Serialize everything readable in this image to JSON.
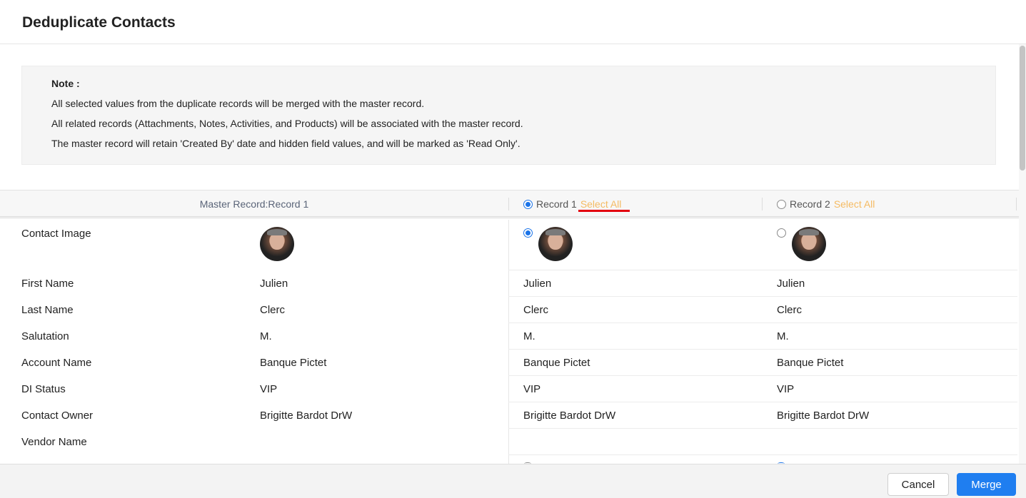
{
  "title": "Deduplicate Contacts",
  "note": {
    "title": "Note :",
    "lines": [
      "All selected values from the duplicate records will be merged with the master record.",
      "All related records (Attachments, Notes, Activities, and Products) will be associated with the master record.",
      "The master record will retain 'Created By' date and hidden field values, and will be marked as 'Read Only'."
    ]
  },
  "columns": {
    "master_label": "Master Record:Record 1",
    "record1_label": "Record 1",
    "record2_label": "Record 2",
    "select_all": "Select All",
    "record1_selected": true,
    "record2_selected": false
  },
  "rows": [
    {
      "label": "Contact Image",
      "master": "",
      "record1": "",
      "record2": ""
    },
    {
      "label": "First Name",
      "master": "Julien",
      "record1": "Julien",
      "record2": "Julien"
    },
    {
      "label": "Last Name",
      "master": "Clerc",
      "record1": "Clerc",
      "record2": "Clerc"
    },
    {
      "label": "Salutation",
      "master": "M.",
      "record1": "M.",
      "record2": "M."
    },
    {
      "label": "Account Name",
      "master": "Banque Pictet",
      "record1": "Banque Pictet",
      "record2": "Banque Pictet"
    },
    {
      "label": "DI Status",
      "master": "VIP",
      "record1": "VIP",
      "record2": "VIP"
    },
    {
      "label": "Contact Owner",
      "master": "Brigitte Bardot DrW",
      "record1": "Brigitte Bardot DrW",
      "record2": "Brigitte Bardot DrW"
    },
    {
      "label": "Vendor Name",
      "master": "",
      "record1": "",
      "record2": ""
    }
  ],
  "footer": {
    "cancel_label": "Cancel",
    "merge_label": "Merge"
  },
  "colors": {
    "accent": "#1f7ef0",
    "select_all": "#f5bb63",
    "highlight_underline": "#e3000f"
  }
}
